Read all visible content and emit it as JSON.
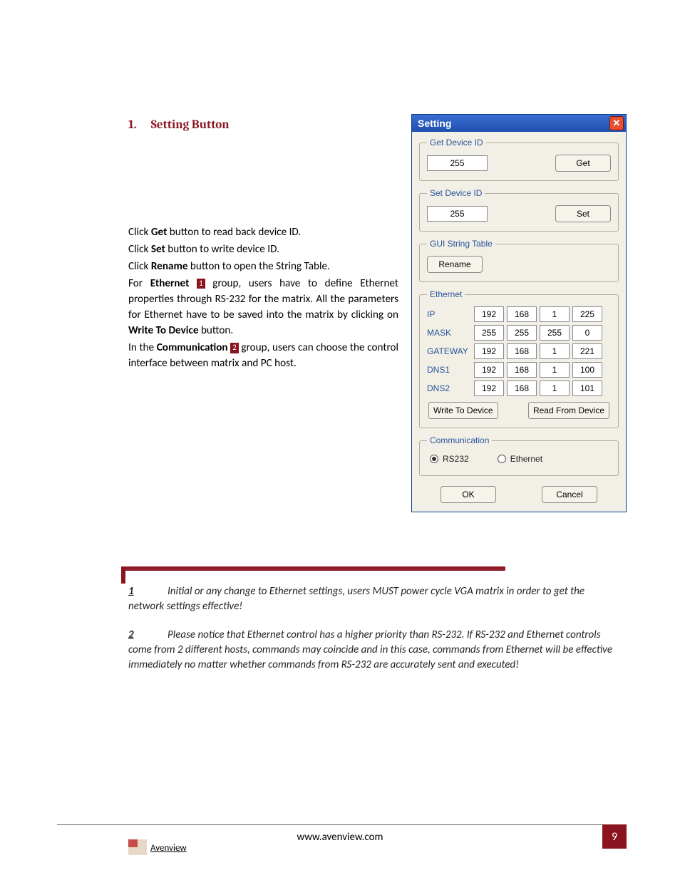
{
  "heading": {
    "num": "1.",
    "text": "Setting Button"
  },
  "body": {
    "p1_a": "Click ",
    "p1_b": "Get",
    "p1_c": " button to read back device ID.",
    "p2_a": "Click ",
    "p2_b": "Set",
    "p2_c": " button to write device ID.",
    "p3_a": "Click ",
    "p3_b": "Rename",
    "p3_c": " button to open the String Table.",
    "p4_a": "For ",
    "p4_b": "Ethernet ",
    "p4_m": "1",
    "p4_c": " group, users have to define Ethernet properties through RS-232 for the matrix. All the parameters for Ethernet have to be saved into the matrix by clicking on ",
    "p4_d": "Write To Device",
    "p4_e": " button.",
    "p5_a": "In the ",
    "p5_b": "Communication ",
    "p5_m": "2",
    "p5_c": " group, users can choose the control interface between matrix and PC host."
  },
  "dialog": {
    "title": "Setting",
    "groups": {
      "get_device": {
        "legend": "Get Device ID",
        "value": "255",
        "button": "Get"
      },
      "set_device": {
        "legend": "Set Device ID",
        "value": "255",
        "button": "Set"
      },
      "gui_string": {
        "legend": "GUI String Table",
        "button": "Rename"
      },
      "ethernet": {
        "legend": "Ethernet",
        "rows": [
          {
            "label": "IP",
            "v": [
              "192",
              "168",
              "1",
              "225"
            ]
          },
          {
            "label": "MASK",
            "v": [
              "255",
              "255",
              "255",
              "0"
            ]
          },
          {
            "label": "GATEWAY",
            "v": [
              "192",
              "168",
              "1",
              "221"
            ]
          },
          {
            "label": "DNS1",
            "v": [
              "192",
              "168",
              "1",
              "100"
            ]
          },
          {
            "label": "DNS2",
            "v": [
              "192",
              "168",
              "1",
              "101"
            ]
          }
        ],
        "write_btn": "Write To Device",
        "read_btn": "Read From Device"
      },
      "communication": {
        "legend": "Communication",
        "rs232": "RS232",
        "ethernet": "Ethernet"
      }
    },
    "ok": "OK",
    "cancel": "Cancel"
  },
  "footnotes": {
    "n1_num": "1",
    "n1_text": "Initial or any change to Ethernet settings, users MUST power cycle VGA matrix in order to get the network settings effective!",
    "n2_num": "2",
    "n2_text": "Please notice that Ethernet control has a higher priority than RS-232. If RS-232 and Ethernet controls come from 2 different hosts, commands may coincide and in this case, commands from Ethernet will be effective immediately no matter whether commands from RS-232 are accurately sent and executed!"
  },
  "footer": {
    "url": "www.avenview.com",
    "page": "9",
    "brand": "Avenview"
  }
}
